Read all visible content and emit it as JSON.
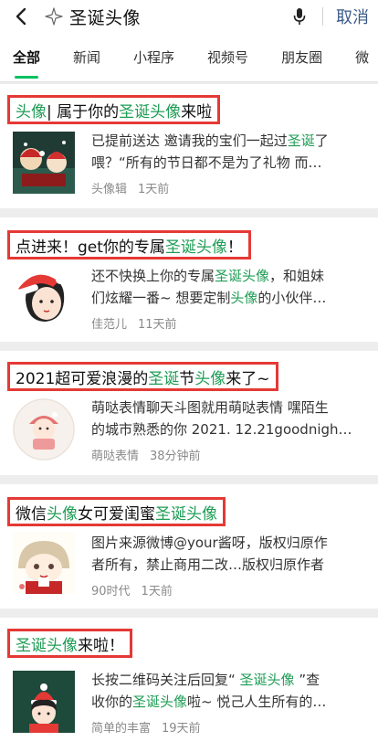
{
  "search": {
    "query": "圣诞头像",
    "cancel_label": "取消"
  },
  "tabs": [
    {
      "label": "全部"
    },
    {
      "label": "新闻"
    },
    {
      "label": "小程序"
    },
    {
      "label": "视频号"
    },
    {
      "label": "朋友圈"
    },
    {
      "label": "微"
    }
  ],
  "results": [
    {
      "title": [
        {
          "t": "头像",
          "h": true
        },
        {
          "t": " | 属于你的",
          "h": false
        },
        {
          "t": "圣诞头像",
          "h": true
        },
        {
          "t": "来啦",
          "h": false
        }
      ],
      "snippet_line1": [
        {
          "t": "已提前送达 邀请我的宝们一起过",
          "h": false
        },
        {
          "t": "圣诞",
          "h": true
        },
        {
          "t": "了",
          "h": false
        }
      ],
      "snippet_line2": [
        {
          "t": "喂？“所有的节日都不是为了礼物 而…",
          "h": false
        }
      ],
      "source": "头像辑",
      "time": "1天前"
    },
    {
      "title": [
        {
          "t": "点进来！get你的专属",
          "h": false
        },
        {
          "t": "圣诞头像",
          "h": true
        },
        {
          "t": "！",
          "h": false
        }
      ],
      "snippet_line1": [
        {
          "t": "还不快换上你的专属",
          "h": false
        },
        {
          "t": "圣诞头像",
          "h": true
        },
        {
          "t": "，和姐妹",
          "h": false
        }
      ],
      "snippet_line2": [
        {
          "t": "们炫耀一番~ 想要定制",
          "h": false
        },
        {
          "t": "头像",
          "h": true
        },
        {
          "t": "的小伙伴…",
          "h": false
        }
      ],
      "source": "佳范儿",
      "time": "11天前"
    },
    {
      "title": [
        {
          "t": "2021超可爱浪漫的",
          "h": false
        },
        {
          "t": "圣诞",
          "h": true
        },
        {
          "t": "节",
          "h": false
        },
        {
          "t": "头像",
          "h": true
        },
        {
          "t": "来了~",
          "h": false
        }
      ],
      "snippet_line1": [
        {
          "t": "萌哒表情聊天斗图就用萌哒表情 嘿陌生",
          "h": false
        }
      ],
      "snippet_line2": [
        {
          "t": "的城市熟悉的你 2021. 12.21goodnigh…",
          "h": false
        }
      ],
      "source": "萌哒表情",
      "time": "38分钟前"
    },
    {
      "title": [
        {
          "t": "微信",
          "h": false
        },
        {
          "t": "头像",
          "h": true
        },
        {
          "t": "女可爱闺蜜",
          "h": false
        },
        {
          "t": "圣诞头像",
          "h": true
        }
      ],
      "snippet_line1": [
        {
          "t": "图片来源微博@your酱呀，版权归原作",
          "h": false
        }
      ],
      "snippet_line2": [
        {
          "t": "者所有，禁止商用二改…版权归原作者",
          "h": false
        }
      ],
      "source": "90时代",
      "time": "1天前"
    },
    {
      "title": [
        {
          "t": "圣诞头像",
          "h": true
        },
        {
          "t": "来啦！",
          "h": false
        }
      ],
      "snippet_line1": [
        {
          "t": "长按二维码关注后回复“ ",
          "h": false
        },
        {
          "t": "圣诞头像",
          "h": true
        },
        {
          "t": " ”查",
          "h": false
        }
      ],
      "snippet_line2": [
        {
          "t": "收你的",
          "h": false
        },
        {
          "t": "圣诞头像",
          "h": true
        },
        {
          "t": "啦~ 悦己人生所有的…",
          "h": false
        }
      ],
      "source": "简单的丰富",
      "time": "19天前"
    }
  ],
  "colors": {
    "highlight": "#1f9d55",
    "annotation_box": "#e53935",
    "tab_indicator": "#07c160",
    "cancel": "#3b5b8a"
  }
}
